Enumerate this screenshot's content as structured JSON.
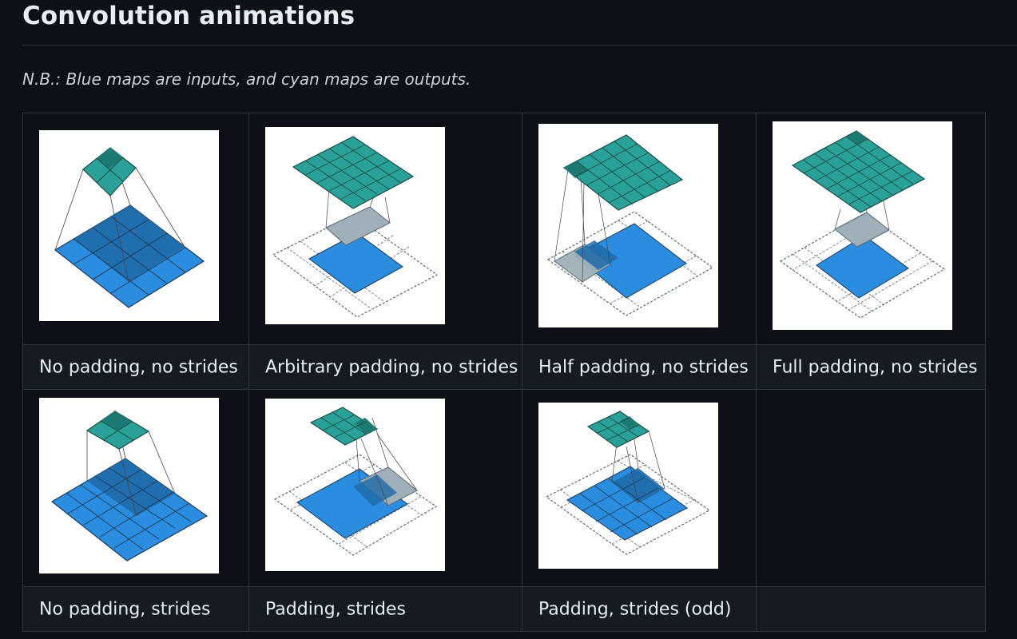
{
  "heading": "Convolution animations",
  "note": "N.B.: Blue maps are inputs, and cyan maps are outputs.",
  "colors": {
    "background": "#0d1117",
    "caption_row": "#161b22",
    "border": "#30363d",
    "input_blue": "#2a8ddf",
    "output_cyan": "#2aa198",
    "kernel_gray": "#9fb0b8"
  },
  "cells": [
    {
      "caption": "No padding, no strides",
      "icon": "convolution-no-padding-no-strides-diagram"
    },
    {
      "caption": "Arbitrary padding, no strides",
      "icon": "convolution-arbitrary-padding-diagram"
    },
    {
      "caption": "Half padding, no strides",
      "icon": "convolution-half-padding-diagram"
    },
    {
      "caption": "Full padding, no strides",
      "icon": "convolution-full-padding-diagram"
    },
    {
      "caption": "No padding, strides",
      "icon": "convolution-no-padding-strides-diagram"
    },
    {
      "caption": "Padding, strides",
      "icon": "convolution-padding-strides-diagram"
    },
    {
      "caption": "Padding, strides (odd)",
      "icon": "convolution-padding-strides-odd-diagram"
    }
  ]
}
